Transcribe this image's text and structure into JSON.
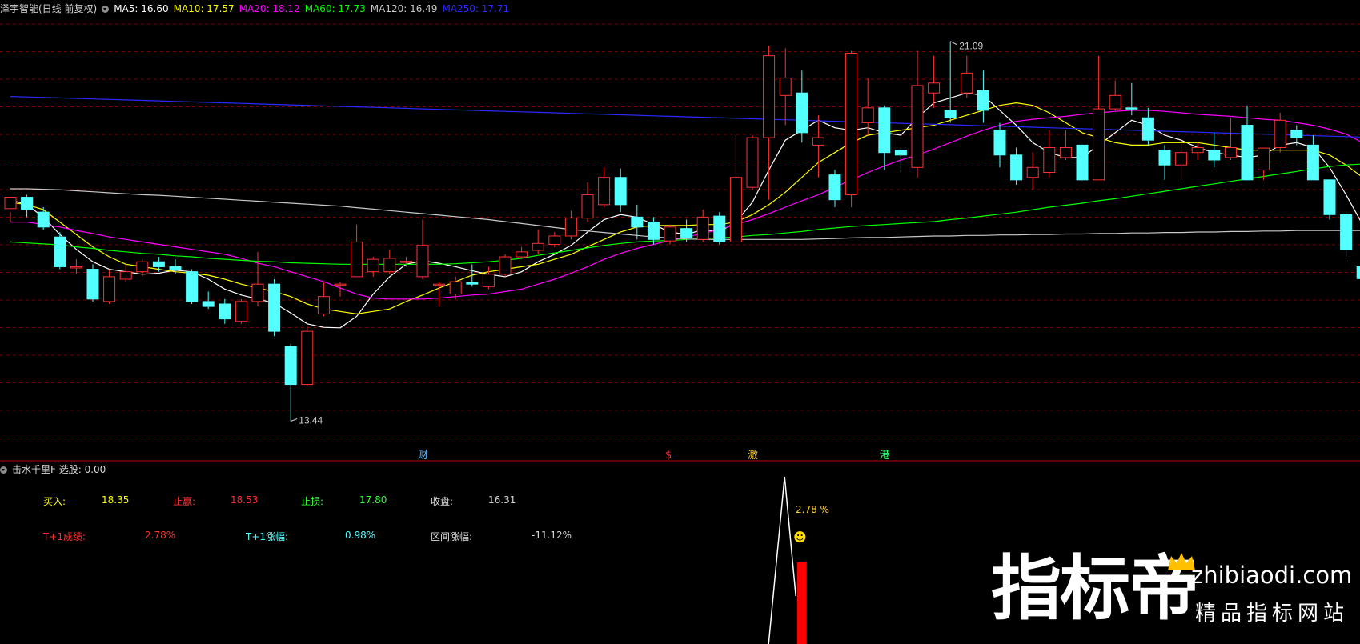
{
  "header": {
    "title": "泽宇智能(日线 前复权)",
    "ma": [
      {
        "label": "MA5: 16.60",
        "color": "#ffffff"
      },
      {
        "label": "MA10: 17.57",
        "color": "#ffff00"
      },
      {
        "label": "MA20: 18.12",
        "color": "#ff00ff"
      },
      {
        "label": "MA60: 17.73",
        "color": "#00ff00"
      },
      {
        "label": "MA120: 16.49",
        "color": "#c8c8c8"
      },
      {
        "label": "MA250: 17.71",
        "color": "#2a2aff"
      }
    ]
  },
  "indicator": {
    "title": "击水千里F  选股: 0.00",
    "buy_label": "买入:",
    "buy_value": "18.35",
    "profit_label": "止赢:",
    "profit_value": "18.53",
    "stop_label": "止损:",
    "stop_value": "17.80",
    "close_label": "收盘:",
    "close_value": "16.31",
    "t1_label": "T+1成绩:",
    "t1_value": "2.78%",
    "t1rise_label": "T+1涨幅:",
    "t1rise_value": "0.98%",
    "range_label": "区间涨幅:",
    "range_value": "-11.12%",
    "bar_label": "2.78 %",
    "smiley": "☻"
  },
  "watermark": {
    "main": "指标帝",
    "domain": "zhibiaodi.com",
    "sub": "精品指标网站"
  },
  "colors": {
    "up": "#ff3232",
    "down": "#54ffff",
    "grid": "#7a0000",
    "divider": "#c00000",
    "ma5": "#ffffff",
    "ma10": "#ffff00",
    "ma20": "#ff00ff",
    "ma60": "#00ff00",
    "ma120": "#c8c8c8",
    "ma250": "#2a2aff"
  },
  "chart_data": {
    "type": "candlestick",
    "price_range": [
      12.9,
      21.6
    ],
    "high_marker": "21.09",
    "low_marker": "13.44",
    "candles": [
      [
        17.72,
        17.95,
        17.65,
        17.45
      ],
      [
        17.95,
        17.7,
        18.0,
        17.55
      ],
      [
        17.65,
        17.35,
        17.75,
        17.3
      ],
      [
        17.15,
        16.55,
        17.25,
        16.5
      ],
      [
        16.55,
        16.55,
        16.7,
        16.4
      ],
      [
        16.5,
        15.9,
        16.6,
        15.85
      ],
      [
        15.85,
        16.35,
        16.5,
        15.8
      ],
      [
        16.3,
        16.45,
        16.6,
        16.25
      ],
      [
        16.45,
        16.65,
        16.7,
        16.35
      ],
      [
        16.65,
        16.55,
        16.75,
        16.45
      ],
      [
        16.55,
        16.5,
        16.7,
        16.4
      ],
      [
        16.45,
        15.85,
        16.5,
        15.8
      ],
      [
        15.85,
        15.75,
        16.05,
        15.7
      ],
      [
        15.8,
        15.5,
        15.9,
        15.4
      ],
      [
        15.45,
        15.85,
        15.9,
        15.4
      ],
      [
        15.85,
        16.2,
        16.85,
        15.75
      ],
      [
        16.2,
        15.25,
        16.3,
        15.15
      ],
      [
        14.95,
        14.18,
        15.0,
        13.44
      ],
      [
        14.18,
        15.25,
        15.35,
        14.15
      ],
      [
        15.6,
        15.95,
        16.25,
        15.55
      ],
      [
        16.2,
        16.2,
        16.25,
        15.95
      ],
      [
        16.35,
        17.05,
        17.4,
        16.4
      ],
      [
        16.45,
        16.7,
        16.75,
        16.35
      ],
      [
        16.45,
        16.72,
        16.9,
        16.4
      ],
      [
        16.65,
        16.66,
        16.75,
        16.55
      ],
      [
        16.35,
        16.98,
        17.5,
        16.3
      ],
      [
        16.2,
        16.2,
        16.25,
        15.75
      ],
      [
        16.0,
        16.25,
        16.35,
        15.9
      ],
      [
        16.23,
        16.2,
        16.6,
        16.15
      ],
      [
        16.15,
        16.4,
        16.55,
        16.1
      ],
      [
        16.4,
        16.75,
        16.8,
        16.35
      ],
      [
        16.75,
        16.85,
        16.95,
        16.7
      ],
      [
        16.88,
        17.02,
        17.3,
        16.8
      ],
      [
        17.0,
        17.17,
        17.25,
        16.95
      ],
      [
        17.17,
        17.53,
        17.68,
        17.1
      ],
      [
        17.53,
        18.0,
        18.25,
        17.45
      ],
      [
        17.8,
        18.35,
        18.55,
        17.75
      ],
      [
        18.35,
        17.8,
        18.53,
        17.65
      ],
      [
        17.55,
        17.35,
        17.8,
        17.1
      ],
      [
        17.45,
        17.1,
        17.55,
        17.0
      ],
      [
        17.07,
        17.35,
        17.4,
        17.0
      ],
      [
        17.32,
        17.13,
        17.5,
        17.05
      ],
      [
        17.1,
        17.55,
        17.7,
        17.05
      ],
      [
        17.57,
        17.05,
        17.65,
        17.0
      ],
      [
        17.05,
        18.35,
        19.2,
        17.05
      ],
      [
        18.15,
        19.15,
        19.2,
        18.1
      ],
      [
        19.15,
        20.8,
        21.0,
        17.9
      ],
      [
        20.0,
        20.35,
        20.95,
        19.4
      ],
      [
        20.05,
        19.25,
        20.5,
        19.05
      ],
      [
        19.0,
        19.15,
        19.6,
        18.35
      ],
      [
        18.4,
        17.9,
        18.5,
        17.75
      ],
      [
        18.0,
        20.85,
        20.9,
        17.75
      ],
      [
        19.45,
        19.75,
        20.35,
        19.2
      ],
      [
        19.75,
        18.85,
        19.8,
        18.5
      ],
      [
        18.9,
        18.8,
        18.95,
        18.45
      ],
      [
        18.55,
        20.2,
        20.9,
        18.35
      ],
      [
        20.05,
        20.25,
        20.8,
        19.75
      ],
      [
        19.7,
        19.55,
        21.09,
        19.45
      ],
      [
        20.05,
        20.45,
        20.8,
        19.95
      ],
      [
        20.1,
        19.7,
        20.5,
        19.45
      ],
      [
        19.3,
        18.8,
        19.45,
        18.55
      ],
      [
        18.8,
        18.3,
        18.95,
        18.2
      ],
      [
        18.35,
        18.55,
        18.85,
        18.1
      ],
      [
        18.45,
        18.95,
        19.3,
        18.35
      ],
      [
        18.75,
        18.95,
        19.3,
        18.7
      ],
      [
        19.0,
        18.3,
        19.0,
        18.35
      ],
      [
        18.3,
        19.73,
        20.8,
        18.3
      ],
      [
        19.73,
        20.0,
        20.3,
        19.7
      ],
      [
        19.75,
        19.73,
        20.25,
        19.6
      ],
      [
        19.55,
        19.1,
        19.75,
        19.0
      ],
      [
        18.9,
        18.6,
        19.0,
        18.3
      ],
      [
        18.6,
        18.85,
        19.1,
        18.3
      ],
      [
        18.85,
        18.95,
        19.05,
        18.7
      ],
      [
        18.9,
        18.7,
        19.25,
        18.55
      ],
      [
        18.75,
        18.95,
        19.55,
        18.7
      ],
      [
        19.4,
        18.3,
        19.8,
        18.35
      ],
      [
        18.5,
        18.94,
        18.95,
        18.3
      ],
      [
        18.95,
        19.5,
        19.65,
        18.85
      ],
      [
        19.3,
        19.15,
        19.4,
        19.0
      ],
      [
        19.0,
        18.3,
        19.2,
        18.3
      ],
      [
        18.3,
        17.6,
        18.3,
        17.5
      ],
      [
        17.6,
        16.9,
        17.65,
        16.75
      ],
      [
        16.55,
        16.31,
        16.6,
        16.1
      ]
    ],
    "ma_series": {
      "MA5": [
        17.9,
        17.8,
        17.55,
        17.2,
        16.9,
        16.65,
        16.5,
        16.45,
        16.4,
        16.42,
        16.48,
        16.45,
        16.3,
        16.1,
        15.98,
        15.9,
        15.82,
        15.62,
        15.4,
        15.33,
        15.32,
        15.55,
        16.0,
        16.35,
        16.6,
        16.67,
        16.62,
        16.55,
        16.47,
        16.4,
        16.35,
        16.45,
        16.65,
        16.8,
        16.98,
        17.25,
        17.5,
        17.6,
        17.55,
        17.4,
        17.25,
        17.2,
        17.3,
        17.25,
        17.45,
        17.85,
        18.5,
        19.1,
        19.3,
        19.5,
        19.35,
        19.3,
        19.35,
        19.25,
        19.2,
        19.55,
        19.85,
        19.95,
        20.05,
        20.0,
        19.7,
        19.4,
        19.05,
        18.85,
        18.75,
        18.75,
        19.0,
        19.25,
        19.5,
        19.4,
        19.2,
        19.1,
        18.95,
        18.85,
        18.8,
        18.75,
        18.8,
        19.0,
        19.05,
        18.95,
        18.55,
        18.0,
        17.4
      ],
      "MA10": [
        17.85,
        17.8,
        17.7,
        17.45,
        17.2,
        16.95,
        16.75,
        16.6,
        16.55,
        16.5,
        16.45,
        16.42,
        16.38,
        16.3,
        16.2,
        16.12,
        16.05,
        15.95,
        15.8,
        15.7,
        15.65,
        15.6,
        15.65,
        15.7,
        15.85,
        15.98,
        16.12,
        16.25,
        16.38,
        16.45,
        16.5,
        16.55,
        16.6,
        16.7,
        16.8,
        16.95,
        17.1,
        17.25,
        17.35,
        17.38,
        17.38,
        17.38,
        17.4,
        17.4,
        17.45,
        17.6,
        17.8,
        18.05,
        18.35,
        18.65,
        18.85,
        19.05,
        19.2,
        19.25,
        19.3,
        19.35,
        19.4,
        19.5,
        19.6,
        19.7,
        19.8,
        19.85,
        19.8,
        19.65,
        19.45,
        19.25,
        19.15,
        19.05,
        19.0,
        19.0,
        19.05,
        19.05,
        19.05,
        19.0,
        18.95,
        18.9,
        18.9,
        18.9,
        18.9,
        18.9,
        18.8,
        18.6,
        18.35
      ],
      "MA20": [
        17.45,
        17.45,
        17.4,
        17.35,
        17.28,
        17.22,
        17.15,
        17.1,
        17.05,
        17.0,
        16.95,
        16.9,
        16.85,
        16.8,
        16.72,
        16.62,
        16.55,
        16.45,
        16.35,
        16.25,
        16.12,
        16.0,
        15.92,
        15.9,
        15.9,
        15.9,
        15.92,
        15.95,
        15.98,
        16.0,
        16.05,
        16.1,
        16.2,
        16.3,
        16.42,
        16.55,
        16.7,
        16.82,
        16.92,
        17.0,
        17.08,
        17.15,
        17.22,
        17.3,
        17.4,
        17.5,
        17.62,
        17.75,
        17.88,
        18.0,
        18.15,
        18.3,
        18.45,
        18.58,
        18.7,
        18.8,
        18.92,
        19.05,
        19.18,
        19.3,
        19.4,
        19.48,
        19.52,
        19.55,
        19.58,
        19.62,
        19.65,
        19.68,
        19.7,
        19.7,
        19.68,
        19.65,
        19.62,
        19.6,
        19.58,
        19.55,
        19.52,
        19.5,
        19.45,
        19.4,
        19.32,
        19.22,
        19.05
      ],
      "MA60": [
        17.05,
        17.03,
        17.01,
        16.99,
        16.95,
        16.92,
        16.88,
        16.85,
        16.82,
        16.8,
        16.77,
        16.75,
        16.72,
        16.7,
        16.68,
        16.66,
        16.65,
        16.63,
        16.62,
        16.61,
        16.6,
        16.6,
        16.6,
        16.6,
        16.6,
        16.6,
        16.6,
        16.61,
        16.63,
        16.65,
        16.68,
        16.72,
        16.78,
        16.83,
        16.88,
        16.93,
        16.98,
        17.02,
        17.05,
        17.07,
        17.08,
        17.1,
        17.12,
        17.13,
        17.15,
        17.18,
        17.2,
        17.23,
        17.26,
        17.3,
        17.33,
        17.36,
        17.38,
        17.4,
        17.42,
        17.44,
        17.46,
        17.5,
        17.53,
        17.57,
        17.61,
        17.65,
        17.7,
        17.75,
        17.79,
        17.83,
        17.88,
        17.92,
        17.97,
        18.02,
        18.07,
        18.12,
        18.17,
        18.22,
        18.27,
        18.32,
        18.37,
        18.42,
        18.47,
        18.52,
        18.57,
        18.6,
        18.62
      ],
      "MA120": [
        18.12,
        18.12,
        18.11,
        18.1,
        18.08,
        18.06,
        18.04,
        18.02,
        18.0,
        17.99,
        17.97,
        17.95,
        17.93,
        17.91,
        17.89,
        17.87,
        17.85,
        17.83,
        17.81,
        17.79,
        17.77,
        17.74,
        17.71,
        17.68,
        17.65,
        17.62,
        17.59,
        17.56,
        17.53,
        17.5,
        17.46,
        17.42,
        17.38,
        17.34,
        17.3,
        17.27,
        17.24,
        17.21,
        17.18,
        17.15,
        17.13,
        17.11,
        17.1,
        17.1,
        17.1,
        17.1,
        17.1,
        17.1,
        17.1,
        17.11,
        17.12,
        17.13,
        17.14,
        17.14,
        17.15,
        17.16,
        17.17,
        17.17,
        17.18,
        17.18,
        17.19,
        17.19,
        17.2,
        17.2,
        17.21,
        17.21,
        17.22,
        17.22,
        17.23,
        17.23,
        17.24,
        17.24,
        17.25,
        17.25,
        17.26,
        17.26,
        17.27,
        17.27,
        17.28,
        17.28,
        17.28,
        17.28,
        17.28
      ],
      "MA250": [
        19.98,
        19.97,
        19.96,
        19.95,
        19.94,
        19.93,
        19.92,
        19.91,
        19.9,
        19.89,
        19.88,
        19.87,
        19.86,
        19.85,
        19.84,
        19.83,
        19.82,
        19.81,
        19.8,
        19.79,
        19.78,
        19.77,
        19.76,
        19.75,
        19.74,
        19.73,
        19.72,
        19.71,
        19.7,
        19.69,
        19.68,
        19.67,
        19.66,
        19.65,
        19.64,
        19.63,
        19.62,
        19.61,
        19.6,
        19.59,
        19.58,
        19.57,
        19.56,
        19.55,
        19.54,
        19.53,
        19.52,
        19.51,
        19.5,
        19.49,
        19.48,
        19.47,
        19.46,
        19.45,
        19.44,
        19.43,
        19.42,
        19.41,
        19.4,
        19.39,
        19.38,
        19.37,
        19.36,
        19.35,
        19.34,
        19.33,
        19.32,
        19.31,
        19.3,
        19.29,
        19.28,
        19.27,
        19.26,
        19.25,
        19.24,
        19.23,
        19.22,
        19.21,
        19.2,
        19.19,
        19.18,
        19.17,
        19.16
      ]
    },
    "event_markers": [
      {
        "index": 25,
        "label": "财",
        "color": "#5cb0ff"
      },
      {
        "index": 40,
        "label": "$",
        "color": "#ff3030"
      },
      {
        "index": 45,
        "label": "激",
        "color": "#ffcc33"
      },
      {
        "index": 53,
        "label": "港",
        "color": "#33ff66"
      }
    ],
    "indicator_peak_index": 47,
    "indicator_bar_index": 48
  }
}
